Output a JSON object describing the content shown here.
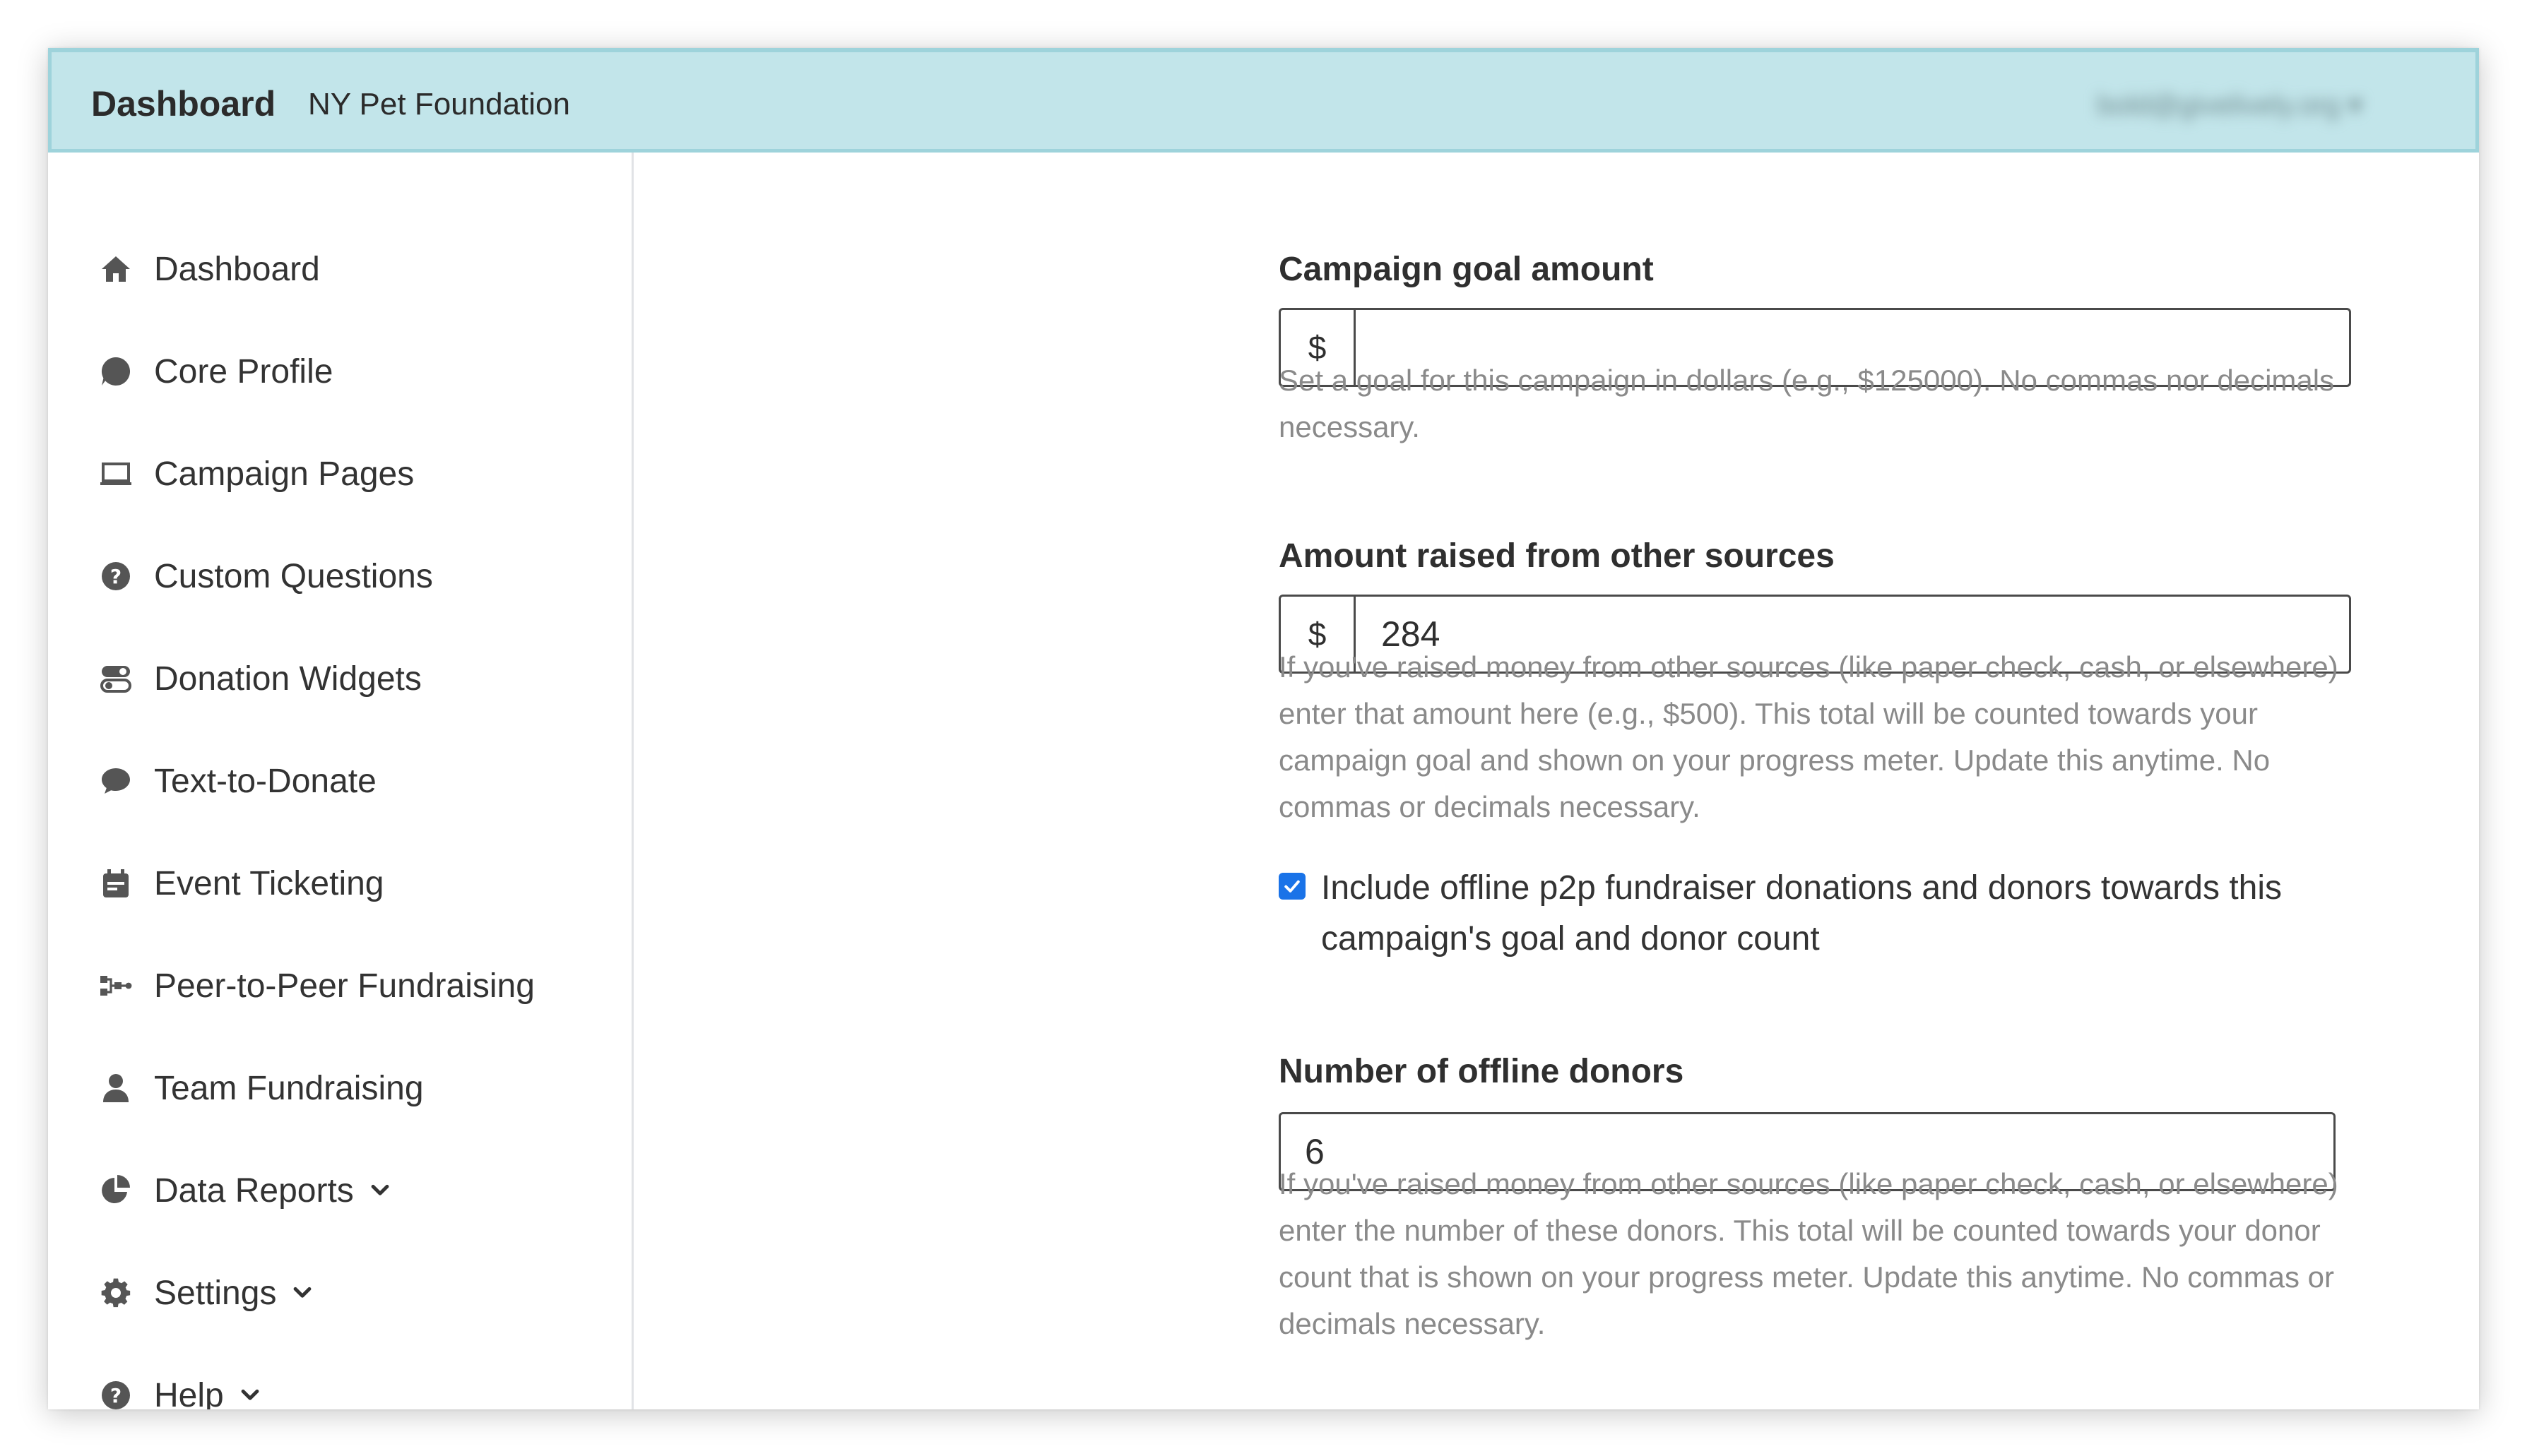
{
  "topbar": {
    "title": "Dashboard",
    "organization": "NY Pet Foundation",
    "user_email": "bold@givelively.org"
  },
  "sidebar": {
    "items": [
      {
        "label": "Dashboard",
        "icon": "home-icon"
      },
      {
        "label": "Core Profile",
        "icon": "bookmark-icon"
      },
      {
        "label": "Campaign Pages",
        "icon": "laptop-icon"
      },
      {
        "label": "Custom Questions",
        "icon": "question-circle-icon"
      },
      {
        "label": "Donation Widgets",
        "icon": "toggle-icon"
      },
      {
        "label": "Text-to-Donate",
        "icon": "comment-icon"
      },
      {
        "label": "Event Ticketing",
        "icon": "calendar-icon"
      },
      {
        "label": "Peer-to-Peer Fundraising",
        "icon": "share-nodes-icon"
      },
      {
        "label": "Team Fundraising",
        "icon": "user-icon"
      },
      {
        "label": "Data Reports",
        "icon": "chart-pie-icon"
      },
      {
        "label": "Settings",
        "icon": "gear-icon"
      },
      {
        "label": "Help",
        "icon": "question-circle-icon"
      }
    ]
  },
  "form": {
    "goal": {
      "label": "Campaign goal amount",
      "currency": "$",
      "value": "",
      "help": "Set a goal for this campaign in dollars (e.g., $125000). No commas nor decimals necessary."
    },
    "other_sources": {
      "label": "Amount raised from other sources",
      "currency": "$",
      "value": "284",
      "help": "If you've raised money from other sources (like paper check, cash, or elsewhere) enter that amount here (e.g., $500). This total will be counted towards your campaign goal and shown on your progress meter. Update this anytime. No commas or decimals necessary."
    },
    "include_offline": {
      "label": "Include offline p2p fundraiser donations and donors towards this campaign's goal and donor count",
      "checked": true
    },
    "offline_donors": {
      "label": "Number of offline donors",
      "value": "6",
      "help": "If you've raised money from other sources (like paper check, cash, or elsewhere) enter the number of these donors. This total will be counted towards your donor count that is shown on your progress meter. Update this anytime. No commas or decimals necessary."
    }
  },
  "colors": {
    "topbar_bg": "#c2e5ea",
    "checkbox_accent": "#1a73e8"
  }
}
